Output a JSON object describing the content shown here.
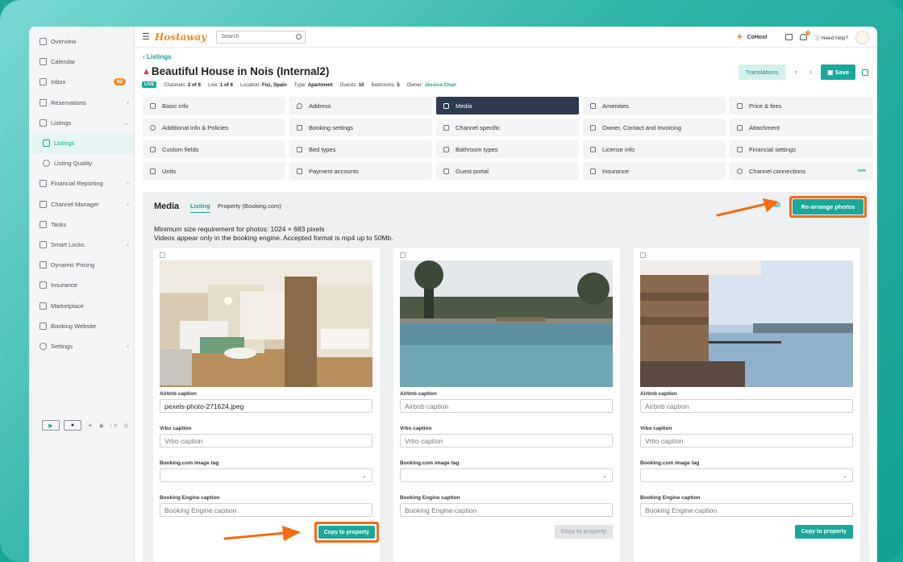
{
  "sidebar": {
    "items": [
      {
        "label": "Overview"
      },
      {
        "label": "Calendar"
      },
      {
        "label": "Inbox",
        "badge": "82"
      },
      {
        "label": "Reservations"
      },
      {
        "label": "Listings"
      },
      {
        "label": "Listings"
      },
      {
        "label": "Listing Quality"
      },
      {
        "label": "Financial Reporting"
      },
      {
        "label": "Channel Manager"
      },
      {
        "label": "Tasks"
      },
      {
        "label": "Smart Locks"
      },
      {
        "label": "Dynamic Pricing"
      },
      {
        "label": "Insurance"
      },
      {
        "label": "Marketplace"
      },
      {
        "label": "Booking Website"
      },
      {
        "label": "Settings"
      }
    ]
  },
  "topbar": {
    "logo": "Hostaway",
    "search_placeholder": "Search",
    "cohost": "CoHost",
    "notif_count": "3",
    "help": "Need help?"
  },
  "header": {
    "breadcrumb": "Listings",
    "title": "Beautiful House in Nois (Internal2)",
    "live": "LIVE",
    "channels_label": "Channels:",
    "channels_value": "2 of 6",
    "live_label": "Live:",
    "live_value": "1 of 6",
    "location_label": "Location:",
    "location_value": "Foz, Spain",
    "type_label": "Type:",
    "type_value": "Apartment",
    "guests_label": "Guests:",
    "guests_value": "10",
    "bedrooms_label": "Bedrooms:",
    "bedrooms_value": "5",
    "owner_label": "Owner:",
    "owner_value": "Jessica Chan",
    "translations": "Translations",
    "save": "Save"
  },
  "tabs": [
    {
      "label": "Basic info",
      "icon": "building-icon"
    },
    {
      "label": "Address",
      "icon": "pin-icon"
    },
    {
      "label": "Media",
      "icon": "image-icon"
    },
    {
      "label": "Amenities",
      "icon": "amenities-icon"
    },
    {
      "label": "Price & fees",
      "icon": "price-icon"
    },
    {
      "label": "Additional info & Policies",
      "icon": "info-icon"
    },
    {
      "label": "Booking settings",
      "icon": "calendar-icon"
    },
    {
      "label": "Channel specific",
      "icon": "layers-icon"
    },
    {
      "label": "Owner, Contact and Invoicing",
      "icon": "user-icon"
    },
    {
      "label": "Attachment",
      "icon": "paperclip-icon"
    },
    {
      "label": "Custom fields",
      "icon": "edit-icon"
    },
    {
      "label": "Bed types",
      "icon": "bed-icon"
    },
    {
      "label": "Bathroom types",
      "icon": "bath-icon"
    },
    {
      "label": "License info",
      "icon": "license-icon"
    },
    {
      "label": "Financial settings",
      "icon": "money-icon"
    },
    {
      "label": "Units",
      "icon": "units-icon"
    },
    {
      "label": "Payment accounts",
      "icon": "card-icon"
    },
    {
      "label": "Guest portal",
      "icon": "portal-icon"
    },
    {
      "label": "Insurance",
      "icon": "house-icon"
    },
    {
      "label": "Channel connections",
      "icon": "link-icon",
      "new": "new"
    }
  ],
  "selected_tab": "Media",
  "media": {
    "title": "Media",
    "tab_listing": "Listing",
    "tab_property": "Property (Booking.com)",
    "all_link": "all",
    "rearrange": "Re-arrange photos",
    "info_line1": "Minimum size requirement for photos: 1024 × 683 pixels",
    "info_line2": "Videos appear only in the booking engine. Accepted format is mp4 up to 50Mb.",
    "cards": [
      {
        "airbnb_label": "Airbnb caption",
        "airbnb_value": "pexels-photo-271624.jpeg",
        "vrbo_label": "Vrbo caption",
        "vrbo_placeholder": "Vrbo caption",
        "booking_tag_label": "Booking.com image tag",
        "engine_label": "Booking Engine caption",
        "engine_placeholder": "Booking Engine caption",
        "button": "Copy to property"
      },
      {
        "airbnb_label": "Airbnb caption",
        "airbnb_placeholder": "Airbnb caption",
        "vrbo_label": "Vrbo caption",
        "vrbo_placeholder": "Vrbo caption",
        "booking_tag_label": "Booking.com image tag",
        "engine_label": "Booking Engine caption",
        "engine_placeholder": "Booking Engine caption",
        "button": "Copy to property"
      },
      {
        "airbnb_label": "Airbnb caption",
        "airbnb_placeholder": "Airbnb caption",
        "vrbo_label": "Vrbo caption",
        "vrbo_placeholder": "Vrbo caption",
        "booking_tag_label": "Booking.com image tag",
        "engine_label": "Booking Engine caption",
        "engine_placeholder": "Booking Engine caption",
        "button": "Copy to property"
      }
    ]
  },
  "colors": {
    "accent": "#1aa89b",
    "highlight": "#f36b12",
    "brand": "#f08a24",
    "selected_tab": "#2d3a4f"
  }
}
